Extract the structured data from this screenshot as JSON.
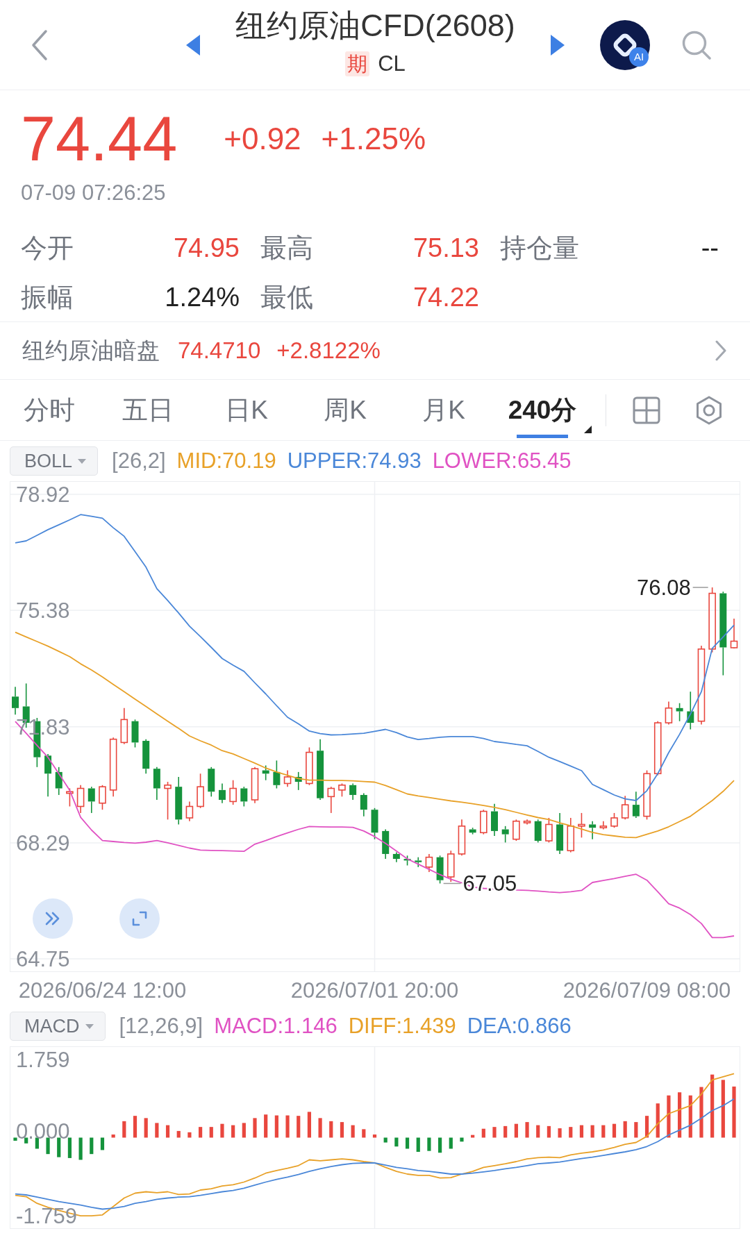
{
  "header": {
    "title": "纽约原油CFD(2608)",
    "badge": "期",
    "code": "CL",
    "ai_label": "AI"
  },
  "quote": {
    "price": "74.44",
    "change": "+0.92",
    "change_percent": "+1.25%",
    "rising": true,
    "time": "07-09 07:26:25"
  },
  "stats": [
    {
      "label": "今开",
      "value": "74.95",
      "color": "#e9473e"
    },
    {
      "label": "最高",
      "value": "75.13",
      "color": "#e9473e"
    },
    {
      "label": "持仓量",
      "value": "--",
      "color": "#222222"
    },
    {
      "label": "振幅",
      "value": "1.24%",
      "color": "#222222"
    },
    {
      "label": "最低",
      "value": "74.22",
      "color": "#e9473e"
    }
  ],
  "dark_pool": {
    "label": "纽约原油暗盘",
    "price": "74.4710",
    "change_percent": "+2.8122%",
    "rising": true
  },
  "tabs": [
    {
      "label": "分时",
      "selected": false,
      "menu": false
    },
    {
      "label": "五日",
      "selected": false,
      "menu": false
    },
    {
      "label": "日K",
      "selected": false,
      "menu": false
    },
    {
      "label": "周K",
      "selected": false,
      "menu": false
    },
    {
      "label": "月K",
      "selected": false,
      "menu": false
    },
    {
      "label": "240分",
      "selected": true,
      "menu": true
    }
  ],
  "indicator": {
    "name": "BOLL",
    "params": "[26,2]",
    "values": [
      {
        "text": "MID:70.19",
        "color": "#e8a128"
      },
      {
        "text": "UPPER:74.93",
        "color": "#4a87d8"
      },
      {
        "text": "LOWER:65.45",
        "color": "#e052c3"
      }
    ]
  },
  "chart": {
    "chart_data": {
      "type": "candlestick",
      "categories": [
        null,
        null,
        null,
        null,
        null,
        null,
        null,
        null,
        "2026/06/24 12:00",
        null,
        null,
        null,
        null,
        null,
        null,
        null,
        null,
        null,
        null,
        null,
        null,
        null,
        null,
        null,
        null,
        null,
        null,
        null,
        null,
        null,
        null,
        null,
        null,
        "2026/07/01 20:00",
        null,
        null,
        null,
        null,
        null,
        null,
        null,
        null,
        null,
        null,
        null,
        null,
        null,
        null,
        null,
        null,
        null,
        null,
        null,
        null,
        null,
        null,
        null,
        null,
        "2026/07/09 08:00",
        null,
        null,
        null,
        null,
        null,
        null,
        null,
        null
      ],
      "ylim": [
        64.37,
        79.3
      ],
      "yticks": [
        78.92,
        75.38,
        71.83,
        68.29,
        64.75
      ],
      "grid": true,
      "ohlc": [
        [
          72.75,
          73.05,
          72.2,
          72.4
        ],
        [
          72.45,
          73.15,
          71.8,
          71.95
        ],
        [
          72.0,
          72.1,
          70.6,
          70.9
        ],
        [
          70.95,
          71.0,
          69.7,
          70.4
        ],
        [
          70.45,
          70.6,
          69.75,
          69.95
        ],
        [
          69.8,
          69.95,
          69.4,
          69.85
        ],
        [
          69.4,
          70.05,
          69.2,
          69.95
        ],
        [
          69.95,
          70.0,
          69.2,
          69.55
        ],
        [
          69.5,
          70.05,
          69.3,
          70.0
        ],
        [
          69.9,
          71.5,
          69.7,
          71.45
        ],
        [
          71.35,
          72.4,
          71.3,
          72.05
        ],
        [
          72.0,
          72.05,
          71.2,
          71.35
        ],
        [
          71.4,
          71.45,
          70.4,
          70.55
        ],
        [
          70.55,
          70.6,
          69.6,
          69.95
        ],
        [
          69.95,
          70.15,
          69.0,
          70.05
        ],
        [
          70.0,
          70.3,
          68.85,
          69.0
        ],
        [
          69.05,
          69.55,
          68.95,
          69.4
        ],
        [
          69.4,
          70.4,
          69.35,
          70.0
        ],
        [
          70.55,
          70.6,
          69.7,
          69.85
        ],
        [
          69.9,
          70.1,
          69.5,
          69.6
        ],
        [
          69.55,
          70.2,
          69.45,
          69.95
        ],
        [
          69.95,
          70.0,
          69.4,
          69.55
        ],
        [
          69.6,
          70.6,
          69.5,
          70.55
        ],
        [
          70.5,
          70.65,
          70.2,
          70.4
        ],
        [
          70.45,
          70.8,
          69.95,
          70.05
        ],
        [
          70.1,
          70.5,
          70.0,
          70.3
        ],
        [
          70.3,
          70.45,
          69.9,
          70.15
        ],
        [
          70.1,
          71.2,
          70.05,
          71.05
        ],
        [
          71.1,
          71.45,
          69.6,
          69.65
        ],
        [
          69.7,
          70.0,
          69.2,
          69.95
        ],
        [
          69.9,
          70.1,
          69.7,
          70.05
        ],
        [
          70.05,
          70.1,
          69.6,
          69.75
        ],
        [
          69.75,
          69.8,
          69.1,
          69.3
        ],
        [
          69.3,
          69.35,
          68.4,
          68.6
        ],
        [
          68.65,
          68.7,
          67.8,
          67.95
        ],
        [
          67.95,
          68.0,
          67.7,
          67.8
        ],
        [
          67.8,
          67.9,
          67.6,
          67.75
        ],
        [
          67.75,
          67.85,
          67.55,
          67.7
        ],
        [
          67.55,
          67.95,
          67.4,
          67.85
        ],
        [
          67.85,
          67.9,
          67.05,
          67.15
        ],
        [
          67.25,
          68.05,
          67.1,
          67.95
        ],
        [
          67.95,
          69.0,
          67.9,
          68.8
        ],
        [
          68.7,
          68.75,
          68.55,
          68.6
        ],
        [
          68.6,
          69.3,
          68.55,
          69.25
        ],
        [
          69.25,
          69.48,
          68.5,
          68.65
        ],
        [
          68.7,
          68.8,
          68.3,
          68.55
        ],
        [
          68.4,
          69.0,
          68.35,
          68.95
        ],
        [
          68.9,
          69.0,
          68.85,
          68.95
        ],
        [
          68.95,
          69.0,
          68.3,
          68.35
        ],
        [
          68.35,
          69.05,
          68.3,
          68.85
        ],
        [
          68.85,
          69.2,
          67.95,
          68.05
        ],
        [
          68.05,
          69.05,
          68.0,
          68.8
        ],
        [
          68.8,
          69.2,
          68.45,
          68.85
        ],
        [
          68.85,
          68.95,
          68.4,
          68.75
        ],
        [
          68.75,
          68.95,
          68.7,
          68.8
        ],
        [
          68.8,
          69.2,
          68.75,
          69.05
        ],
        [
          69.05,
          69.72,
          69.0,
          69.45
        ],
        [
          69.45,
          69.85,
          69.05,
          69.1
        ],
        [
          69.1,
          70.5,
          69.0,
          70.4
        ],
        [
          70.4,
          72.0,
          70.35,
          71.95
        ],
        [
          71.95,
          72.6,
          71.9,
          72.4
        ],
        [
          72.4,
          72.55,
          72.0,
          72.3
        ],
        [
          72.3,
          72.9,
          71.75,
          71.95
        ],
        [
          72.0,
          74.3,
          71.9,
          74.2
        ],
        [
          74.2,
          76.08,
          74.1,
          75.9
        ],
        [
          75.9,
          75.95,
          73.4,
          74.25
        ],
        [
          74.24,
          75.13,
          74.22,
          74.44
        ]
      ],
      "series": [
        {
          "type": "line",
          "color": "#e8a128",
          "values": [
            74.71,
            74.57,
            74.43,
            74.29,
            74.13,
            73.97,
            73.75,
            73.56,
            73.35,
            73.12,
            72.9,
            72.67,
            72.45,
            72.22,
            72.0,
            71.78,
            71.55,
            71.4,
            71.27,
            71.1,
            71.0,
            70.86,
            70.72,
            70.57,
            70.45,
            70.35,
            70.25,
            70.2,
            70.2,
            70.19,
            70.19,
            70.18,
            70.16,
            70.14,
            70.04,
            69.91,
            69.78,
            69.72,
            69.67,
            69.62,
            69.57,
            69.53,
            69.48,
            69.43,
            69.37,
            69.3,
            69.22,
            69.14,
            69.06,
            69.0,
            68.9,
            68.81,
            68.71,
            68.61,
            68.54,
            68.5,
            68.46,
            68.45,
            68.55,
            68.65,
            68.78,
            68.94,
            69.1,
            69.34,
            69.58,
            69.86,
            70.19
          ]
        },
        {
          "type": "line",
          "color": "#4a87d8",
          "values": [
            77.44,
            77.5,
            77.67,
            77.84,
            77.99,
            78.14,
            78.3,
            78.25,
            78.19,
            77.9,
            77.64,
            77.17,
            76.7,
            76.04,
            75.68,
            75.3,
            74.9,
            74.58,
            74.25,
            73.91,
            73.71,
            73.52,
            73.17,
            72.83,
            72.47,
            72.12,
            71.92,
            71.7,
            71.62,
            71.58,
            71.59,
            71.61,
            71.63,
            71.69,
            71.75,
            71.65,
            71.52,
            71.44,
            71.47,
            71.51,
            71.53,
            71.53,
            71.53,
            71.47,
            71.38,
            71.34,
            71.29,
            71.25,
            71.08,
            70.9,
            70.77,
            70.63,
            70.49,
            70.07,
            69.91,
            69.75,
            69.63,
            69.58,
            69.88,
            70.4,
            71.04,
            71.6,
            72.22,
            72.9,
            74.22,
            74.57,
            74.93
          ]
        },
        {
          "type": "line",
          "color": "#e052c3",
          "values": [
            71.99,
            71.63,
            71.26,
            70.9,
            70.4,
            69.89,
            69.07,
            68.68,
            68.36,
            68.33,
            68.3,
            68.28,
            68.31,
            68.36,
            68.29,
            68.21,
            68.13,
            68.07,
            68.06,
            68.05,
            68.04,
            68.03,
            68.25,
            68.36,
            68.48,
            68.59,
            68.7,
            68.79,
            68.78,
            68.77,
            68.77,
            68.76,
            68.65,
            68.48,
            68.27,
            68.04,
            67.8,
            67.64,
            67.48,
            67.32,
            67.18,
            67.07,
            66.94,
            66.9,
            66.88,
            66.87,
            66.85,
            66.84,
            66.82,
            66.79,
            66.77,
            66.8,
            66.84,
            67.08,
            67.14,
            67.2,
            67.27,
            67.33,
            67.15,
            66.8,
            66.43,
            66.3,
            66.1,
            65.83,
            65.4,
            65.4,
            65.45
          ]
        }
      ],
      "annotations": [
        "76.08",
        "67.05"
      ]
    }
  },
  "macd": {
    "name": "MACD",
    "params": "[12,26,9]",
    "values": [
      {
        "text": "MACD:1.146",
        "color": "#e052c3"
      },
      {
        "text": "DIFF:1.439",
        "color": "#e8a128"
      },
      {
        "text": "DEA:0.866",
        "color": "#4a87d8"
      }
    ],
    "chart_data": {
      "type": "bar",
      "categories": [
        null,
        null,
        null,
        null,
        null,
        null,
        null,
        null,
        null,
        null,
        null,
        null,
        null,
        null,
        null,
        null,
        null,
        null,
        null,
        null,
        null,
        null,
        null,
        null,
        null,
        null,
        null,
        null,
        null,
        null,
        null,
        null,
        null,
        null,
        null,
        null,
        null,
        null,
        null,
        null,
        null,
        null,
        null,
        null,
        null,
        null,
        null,
        null,
        null,
        null,
        null,
        null,
        null,
        null,
        null,
        null,
        null,
        null,
        null,
        null,
        null,
        null,
        null,
        null,
        null,
        null,
        null
      ],
      "ylim": [
        -2.04,
        2.04
      ],
      "yticks": [
        1.759,
        {
          "value": 0,
          "label": "0.000"
        },
        -1.759
      ],
      "grid": "x",
      "series": [
        {
          "values": [
            -0.07,
            -0.13,
            -0.25,
            -0.37,
            -0.44,
            -0.46,
            -0.5,
            -0.37,
            -0.28,
            0.07,
            0.37,
            0.49,
            0.44,
            0.33,
            0.28,
            0.15,
            0.12,
            0.24,
            0.24,
            0.31,
            0.28,
            0.33,
            0.44,
            0.52,
            0.5,
            0.5,
            0.49,
            0.58,
            0.44,
            0.37,
            0.35,
            0.28,
            0.19,
            0.07,
            -0.11,
            -0.2,
            -0.25,
            -0.32,
            -0.3,
            -0.34,
            -0.25,
            -0.09,
            0.06,
            0.2,
            0.24,
            0.26,
            0.31,
            0.35,
            0.28,
            0.26,
            0.21,
            0.24,
            0.28,
            0.28,
            0.28,
            0.31,
            0.37,
            0.35,
            0.49,
            0.77,
            0.95,
            1.02,
            0.95,
            1.14,
            1.42,
            1.3,
            1.15
          ],
          "colors": [
            "#15933c",
            "#15933c",
            "#15933c",
            "#15933c",
            "#15933c",
            "#15933c",
            "#15933c",
            "#15933c",
            "#15933c",
            "#e9473e",
            "#e9473e",
            "#e9473e",
            "#e9473e",
            "#e9473e",
            "#e9473e",
            "#e9473e",
            "#e9473e",
            "#e9473e",
            "#e9473e",
            "#e9473e",
            "#e9473e",
            "#e9473e",
            "#e9473e",
            "#e9473e",
            "#e9473e",
            "#e9473e",
            "#e9473e",
            "#e9473e",
            "#e9473e",
            "#e9473e",
            "#e9473e",
            "#e9473e",
            "#e9473e",
            "#e9473e",
            "#15933c",
            "#15933c",
            "#15933c",
            "#15933c",
            "#15933c",
            "#15933c",
            "#15933c",
            "#15933c",
            "#e9473e",
            "#e9473e",
            "#e9473e",
            "#e9473e",
            "#e9473e",
            "#e9473e",
            "#e9473e",
            "#e9473e",
            "#e9473e",
            "#e9473e",
            "#e9473e",
            "#e9473e",
            "#e9473e",
            "#e9473e",
            "#e9473e",
            "#e9473e",
            "#e9473e",
            "#e9473e",
            "#e9473e",
            "#e9473e",
            "#e9473e",
            "#e9473e",
            "#e9473e",
            "#e9473e",
            "#e9473e"
          ]
        },
        {
          "type": "line",
          "color": "#e8a128",
          "values": [
            -1.3,
            -1.33,
            -1.48,
            -1.57,
            -1.64,
            -1.7,
            -1.76,
            -1.76,
            -1.74,
            -1.55,
            -1.36,
            -1.25,
            -1.22,
            -1.24,
            -1.22,
            -1.28,
            -1.27,
            -1.18,
            -1.15,
            -1.09,
            -1.06,
            -1.0,
            -0.91,
            -0.8,
            -0.74,
            -0.69,
            -0.63,
            -0.5,
            -0.52,
            -0.5,
            -0.48,
            -0.5,
            -0.54,
            -0.57,
            -0.67,
            -0.76,
            -0.82,
            -0.85,
            -0.85,
            -0.91,
            -0.9,
            -0.82,
            -0.76,
            -0.67,
            -0.63,
            -0.59,
            -0.54,
            -0.48,
            -0.45,
            -0.44,
            -0.45,
            -0.39,
            -0.35,
            -0.32,
            -0.28,
            -0.22,
            -0.15,
            -0.11,
            0.03,
            0.31,
            0.54,
            0.63,
            0.72,
            0.98,
            1.3,
            1.37,
            1.44
          ]
        },
        {
          "type": "line",
          "color": "#4a87d8",
          "values": [
            -1.27,
            -1.29,
            -1.34,
            -1.39,
            -1.44,
            -1.48,
            -1.52,
            -1.57,
            -1.61,
            -1.59,
            -1.55,
            -1.48,
            -1.44,
            -1.39,
            -1.36,
            -1.34,
            -1.33,
            -1.3,
            -1.26,
            -1.22,
            -1.19,
            -1.14,
            -1.07,
            -1.0,
            -0.94,
            -0.89,
            -0.83,
            -0.76,
            -0.7,
            -0.65,
            -0.61,
            -0.58,
            -0.57,
            -0.57,
            -0.62,
            -0.67,
            -0.7,
            -0.74,
            -0.76,
            -0.79,
            -0.82,
            -0.82,
            -0.8,
            -0.77,
            -0.74,
            -0.7,
            -0.67,
            -0.63,
            -0.59,
            -0.57,
            -0.55,
            -0.51,
            -0.47,
            -0.44,
            -0.4,
            -0.36,
            -0.32,
            -0.27,
            -0.2,
            -0.09,
            0.06,
            0.17,
            0.28,
            0.44,
            0.61,
            0.72,
            0.87
          ]
        }
      ]
    }
  }
}
